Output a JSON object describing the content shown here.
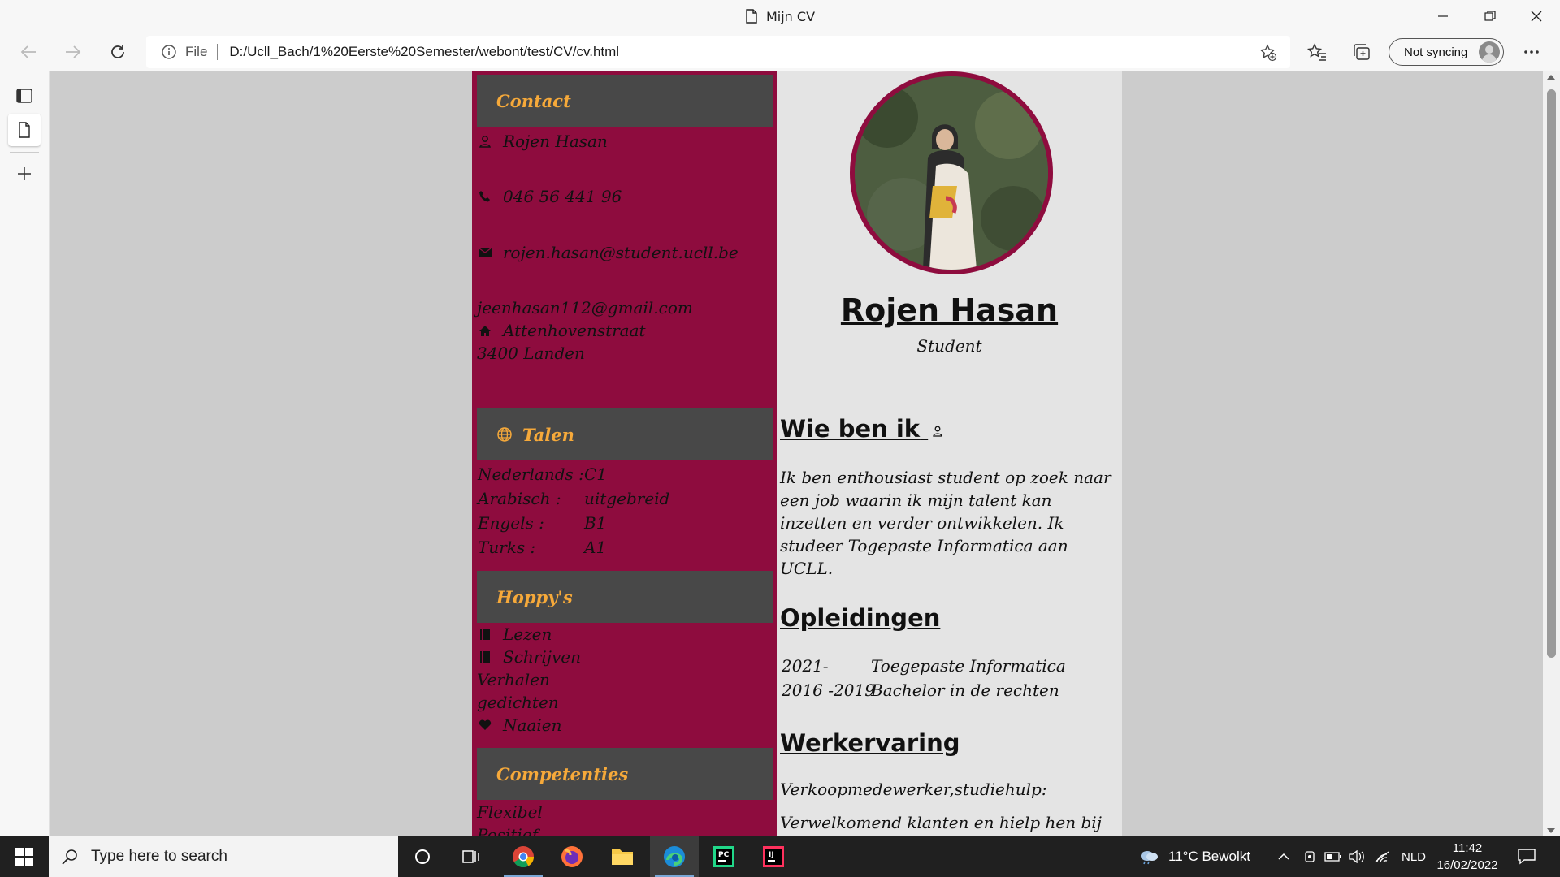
{
  "window": {
    "title": "Mijn CV"
  },
  "address": {
    "scheme_label": "File",
    "url": "D:/Ucll_Bach/1%20Eerste%20Semester/webont/test/CV/cv.html"
  },
  "profile": {
    "sync_label": "Not syncing"
  },
  "cv": {
    "contact": {
      "heading": "Contact",
      "name": "Rojen Hasan",
      "phone": "046 56 441 96",
      "email_school": "rojen.hasan@student.ucll.be",
      "email_personal": "jeenhasan112@gmail.com",
      "street": "Attenhovenstraat",
      "city": "3400 Landen"
    },
    "languages": {
      "heading": "Talen",
      "items": [
        {
          "label": "Nederlands :",
          "level": "C1"
        },
        {
          "label": "Arabisch :",
          "level": "uitgebreid"
        },
        {
          "label": "Engels :",
          "level": "B1"
        },
        {
          "label": "Turks :",
          "level": "A1"
        }
      ]
    },
    "hobbies": {
      "heading": "Hoppy's",
      "lines": [
        "Lezen",
        "Schrijven",
        "Verhalen",
        "gedichten",
        "Naaien"
      ]
    },
    "skills": {
      "heading": "Competenties",
      "items": [
        "Flexibel",
        "Positief"
      ]
    },
    "header": {
      "name": "Rojen Hasan",
      "role": "Student"
    },
    "about": {
      "heading": "Wie ben ik",
      "text": "Ik ben enthousiast student op zoek naar een job waarin ik mijn talent kan inzetten en verder ontwikkelen. Ik studeer Togepaste Informatica aan UCLL."
    },
    "education": {
      "heading": "Opleidingen",
      "items": [
        {
          "years": "2021-",
          "title": "Toegepaste Informatica"
        },
        {
          "years": "2016 -2019",
          "title": "Bachelor in de rechten"
        }
      ]
    },
    "work": {
      "heading": "Werkervaring",
      "role": "Verkoopmedewerker,studiehulp:",
      "desc": "Verwelkomend klanten en hielp hen bij"
    }
  },
  "taskbar": {
    "search_placeholder": "Type here to search",
    "weather": "11°C  Bewolkt",
    "language": "NLD",
    "time": "11:42",
    "date": "16/02/2022"
  },
  "colors": {
    "sidebar": "#8e0c3e",
    "section_header": "#484848",
    "heading_text": "#f6a93a",
    "main_bg": "#e4e4e4"
  }
}
